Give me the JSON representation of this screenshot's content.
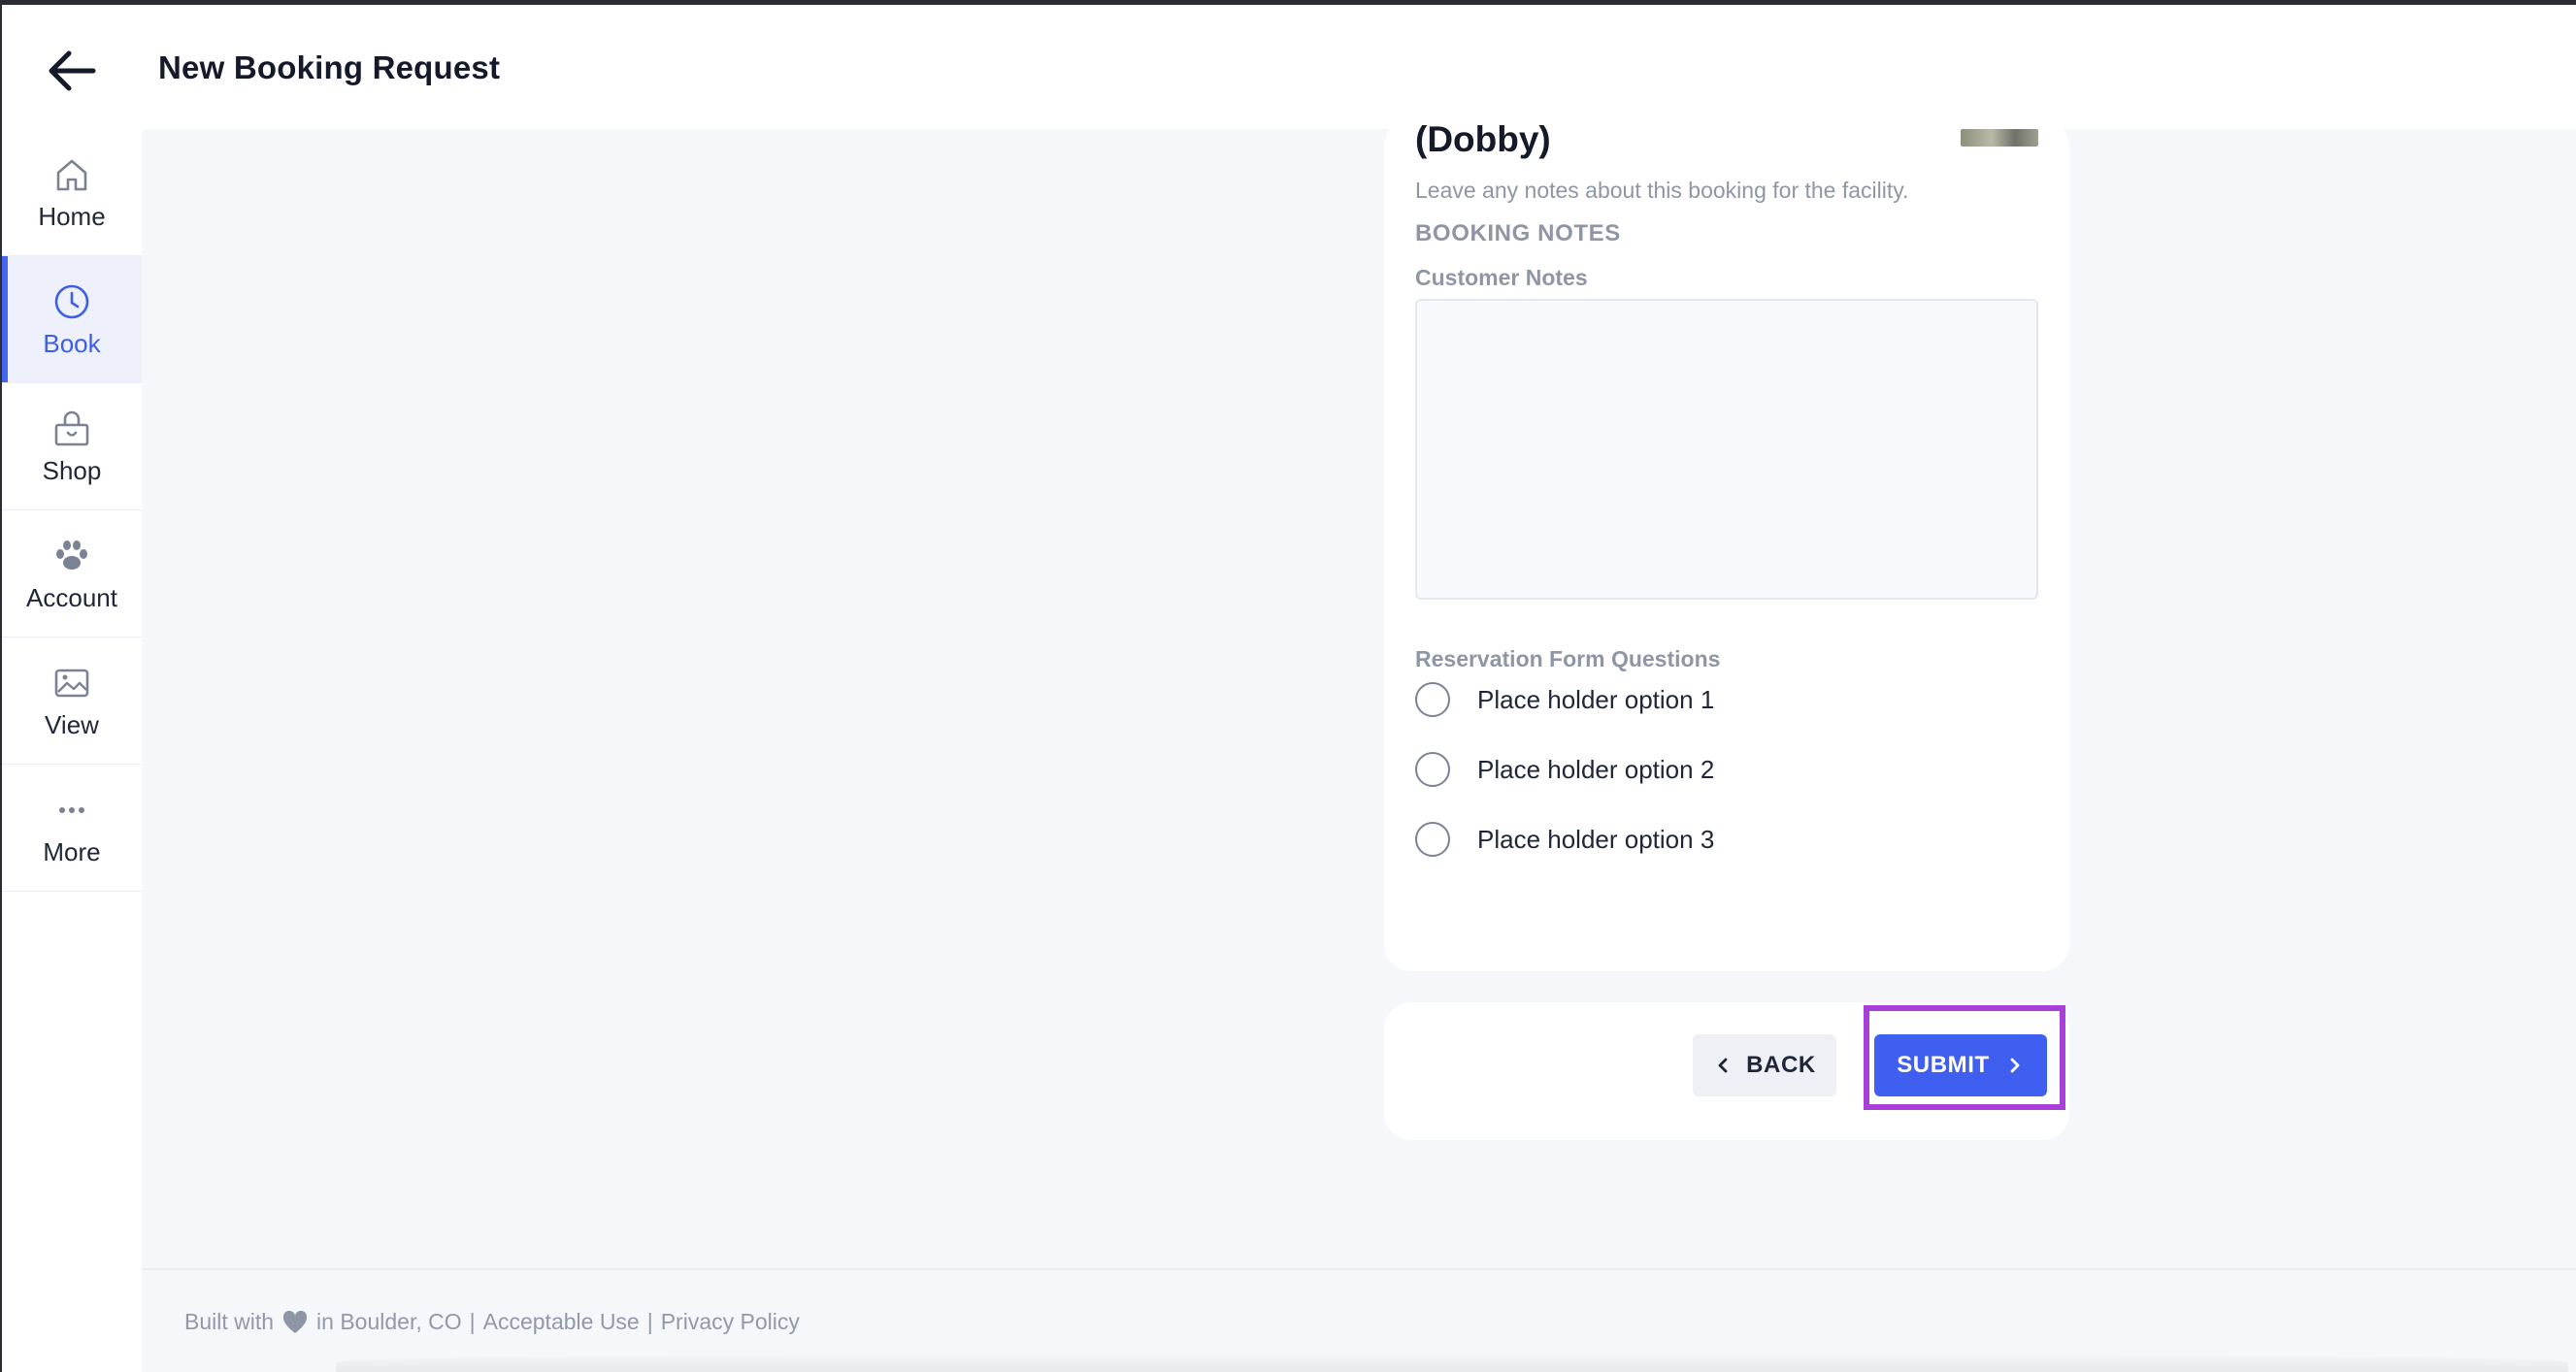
{
  "header": {
    "title": "New Booking Request",
    "back_icon": "arrow-left-icon"
  },
  "sidebar": {
    "accent_color": "#4466ee",
    "items": [
      {
        "label": "Home",
        "icon": "home-icon",
        "active": false
      },
      {
        "label": "Book",
        "icon": "clock-icon",
        "active": true
      },
      {
        "label": "Shop",
        "icon": "shopping-bag-icon",
        "active": false
      },
      {
        "label": "Account",
        "icon": "paw-icon",
        "active": false
      },
      {
        "label": "View",
        "icon": "gallery-icon",
        "active": false
      },
      {
        "label": "More",
        "icon": "more-dots-icon",
        "active": false
      }
    ]
  },
  "booking": {
    "pet_name_partial": "(Dobby)",
    "notes_hint": "Leave any notes about this booking for the facility.",
    "notes_heading": "BOOKING NOTES",
    "customer_notes_label": "Customer Notes",
    "customer_notes_value": "",
    "questions_label": "Reservation Form Questions",
    "options": [
      {
        "label": "Place holder option 1",
        "selected": false
      },
      {
        "label": "Place holder option 2",
        "selected": false
      },
      {
        "label": "Place holder option 3",
        "selected": false
      }
    ]
  },
  "actions": {
    "back_label": "BACK",
    "submit_label": "SUBMIT",
    "submit_color": "#3f5ff0",
    "highlight_color": "#a93fd9"
  },
  "footer": {
    "built_with": "Built with",
    "location": "in Boulder, CO",
    "separator": "|",
    "acceptable_use": "Acceptable Use",
    "privacy_policy": "Privacy Policy"
  }
}
